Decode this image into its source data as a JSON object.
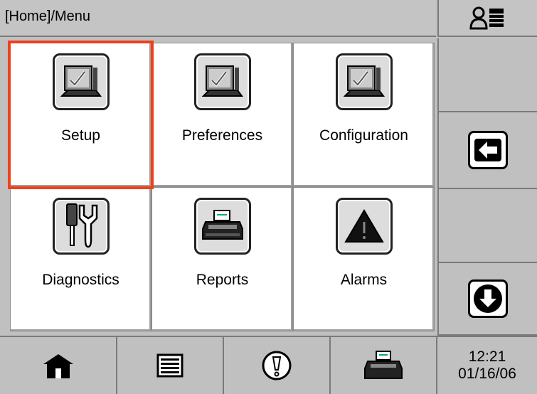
{
  "header": {
    "breadcrumb": "[Home]/Menu",
    "user_icon": "user-list-icon"
  },
  "tiles": [
    {
      "label": "Setup",
      "icon": "monitor-check-icon"
    },
    {
      "label": "Preferences",
      "icon": "monitor-check-icon"
    },
    {
      "label": "Configuration",
      "icon": "monitor-check-icon"
    },
    {
      "label": "Diagnostics",
      "icon": "tools-icon"
    },
    {
      "label": "Reports",
      "icon": "printer-icon"
    },
    {
      "label": "Alarms",
      "icon": "warning-icon"
    }
  ],
  "selected_tile": "Setup",
  "side": {
    "back_icon": "back-arrow-icon",
    "down_icon": "down-arrow-icon"
  },
  "bottom": {
    "home_icon": "home-icon",
    "list_icon": "list-icon",
    "alert_icon": "alert-icon",
    "print_icon": "printer-icon"
  },
  "clock": {
    "time": "12:21",
    "date": "01/16/06"
  },
  "colors": {
    "highlight": "#f0401a",
    "tile_bg": "#ffffff",
    "panel_bg": "#c0c0c0"
  }
}
